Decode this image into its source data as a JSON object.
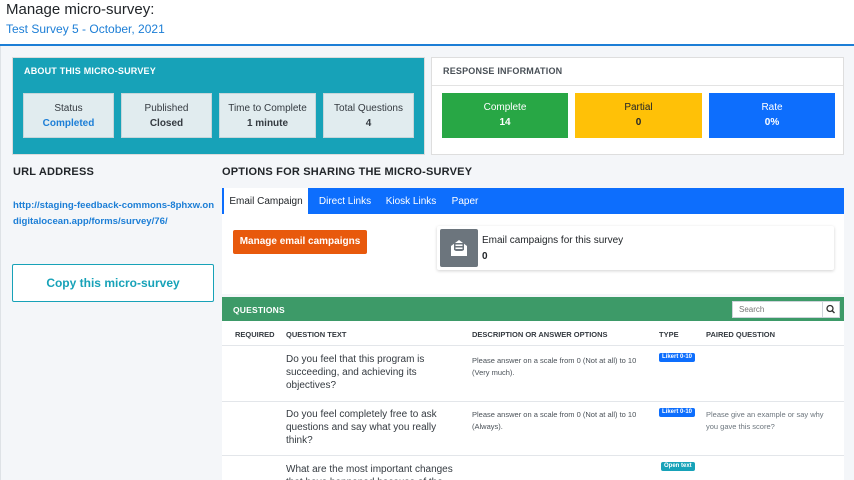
{
  "header": {
    "title": "Manage micro-survey:",
    "survey_name": "Test Survey 5 - October, 2021"
  },
  "about": {
    "title": "ABOUT THIS MICRO-SURVEY",
    "stats": [
      {
        "label": "Status",
        "value": "Completed"
      },
      {
        "label": "Published",
        "value": "Closed"
      },
      {
        "label": "Time to Complete",
        "value": "1 minute"
      },
      {
        "label": "Total Questions",
        "value": "4"
      }
    ]
  },
  "response": {
    "title": "RESPONSE INFORMATION",
    "boxes": [
      {
        "label": "Complete",
        "value": "14",
        "color": "#28a745"
      },
      {
        "label": "Partial",
        "value": "0",
        "color": "#ffc107"
      },
      {
        "label": "Rate",
        "value": "0%",
        "color": "#0d6efd"
      }
    ]
  },
  "url": {
    "heading": "URL ADDRESS",
    "link": "http://staging-feedback-commons-8phxw.ondigitalocean.app/forms/survey/76/",
    "copy_label": "Copy this micro-survey"
  },
  "sharing": {
    "heading": "OPTIONS FOR SHARING THE MICRO-SURVEY",
    "tabs": [
      "Email Campaign",
      "Direct Links",
      "Kiosk Links",
      "Paper"
    ],
    "active_tab": "Email Campaign",
    "manage_label": "Manage email campaigns",
    "info_label": "Email campaigns for this survey",
    "info_count": "0",
    "info_icon": "envelope-open-icon"
  },
  "questions": {
    "title": "QUESTIONS",
    "search_placeholder": "Search",
    "columns": [
      "REQUIRED",
      "QUESTION TEXT",
      "DESCRIPTION OR ANSWER OPTIONS",
      "TYPE",
      "PAIRED QUESTION"
    ],
    "rows": [
      {
        "text": "Do you feel that this program is succeeding, and achieving its objectives?",
        "description": "Please answer on a scale from 0 (Not at all) to 10 (Very much).",
        "type": "Likert 0-10",
        "paired": ""
      },
      {
        "text": "Do you feel completely free to ask questions and say what you really think?",
        "description": "Please answer on a scale from 0 (Not at all) to 10 (Always).",
        "type": "Likert 0-10",
        "paired": "Please give an example or say why you gave this score?"
      },
      {
        "text": "What are the most important changes that have happened because of the Tool",
        "description": "",
        "type": "Open text",
        "paired": ""
      }
    ]
  },
  "colors": {
    "accent": "#1c7ed6",
    "about_bg": "#17a2b8",
    "questions_header": "#3d9a68",
    "tabs_bg": "#0d6efd",
    "manage_button": "#e8590c"
  }
}
